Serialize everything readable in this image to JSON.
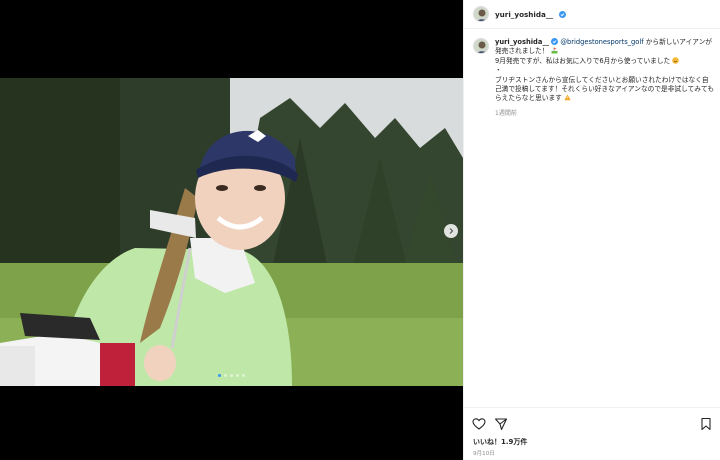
{
  "post": {
    "username": "yuri_yoshida__",
    "caption": {
      "username": "yuri_yoshida__",
      "mention": "@bridgestonesports_golf",
      "line1_after_mention": " から新しいアイアンが発売されました！",
      "line2": "9月発売ですが、私はお気に入りで6月から使っていました",
      "line3": "・",
      "line4": "ブリヂストンさんから宣伝してくださいとお願いされたわけではなく自己満で投稿してます！それくらい好きなアイアンなので是非試してみてもらえたらなと思います",
      "time": "1週間前"
    },
    "likes": "いいね！1.9万件",
    "date": "9月10日"
  },
  "media": {
    "carousel_count": 5,
    "active_index": 0
  },
  "icons": {
    "verified": "verified-badge-icon",
    "like": "heart-icon",
    "share": "send-icon",
    "save": "bookmark-icon",
    "next": "chevron-right-icon"
  },
  "colors": {
    "verified": "#3897f0",
    "mention": "#00376b",
    "muted": "#8e8e8e"
  }
}
